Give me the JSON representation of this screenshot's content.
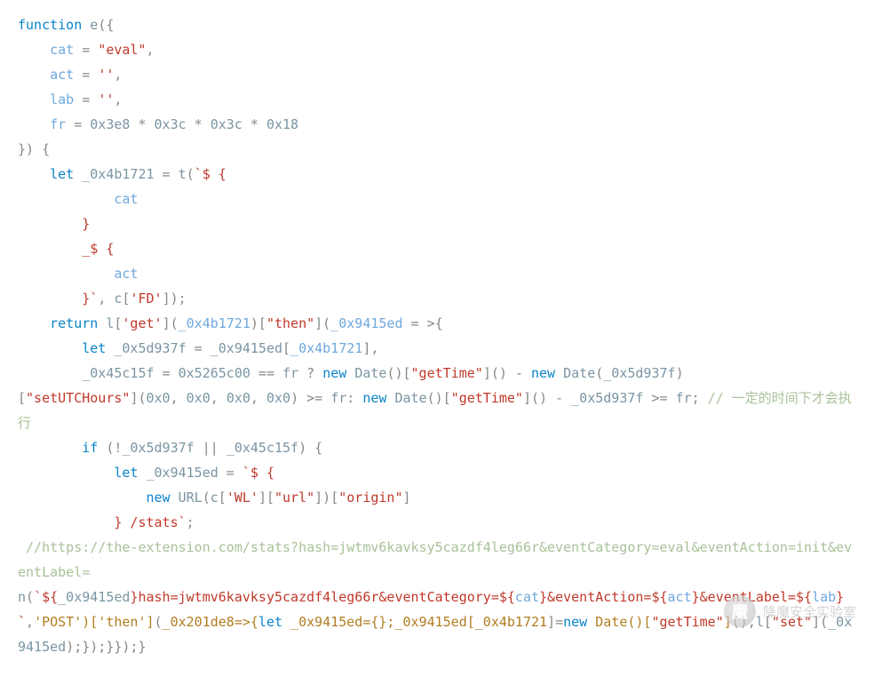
{
  "code": {
    "lines": [
      {
        "indent": 0,
        "spans": [
          [
            "kw",
            "function"
          ],
          [
            "",
            ""
          ],
          [
            "id",
            " e"
          ],
          [
            "op",
            "({"
          ]
        ]
      },
      {
        "indent": 1,
        "spans": [
          [
            "param",
            "cat"
          ],
          [
            "op",
            " = "
          ],
          [
            "str",
            "\"eval\""
          ],
          [
            "op",
            ","
          ]
        ]
      },
      {
        "indent": 1,
        "spans": [
          [
            "param",
            "act"
          ],
          [
            "op",
            " = "
          ],
          [
            "str",
            "''"
          ],
          [
            "op",
            ","
          ]
        ]
      },
      {
        "indent": 1,
        "spans": [
          [
            "param",
            "lab"
          ],
          [
            "op",
            " = "
          ],
          [
            "str",
            "''"
          ],
          [
            "op",
            ","
          ]
        ]
      },
      {
        "indent": 1,
        "spans": [
          [
            "param",
            "fr"
          ],
          [
            "op",
            " = "
          ],
          [
            "num",
            "0x3e8"
          ],
          [
            "op",
            " * "
          ],
          [
            "num",
            "0x3c"
          ],
          [
            "op",
            " * "
          ],
          [
            "num",
            "0x3c"
          ],
          [
            "op",
            " * "
          ],
          [
            "num",
            "0x18"
          ]
        ]
      },
      {
        "indent": 0,
        "spans": [
          [
            "op",
            "}) {"
          ]
        ]
      },
      {
        "indent": 1,
        "spans": [
          [
            "kw",
            "let"
          ],
          [
            "var",
            " _0x4b1721"
          ],
          [
            "op",
            " = "
          ],
          [
            "id",
            "t"
          ],
          [
            "op",
            "("
          ],
          [
            "tmpl",
            "`$ {"
          ]
        ]
      },
      {
        "indent": 3,
        "spans": [
          [
            "param",
            "cat"
          ]
        ]
      },
      {
        "indent": 2,
        "spans": [
          [
            "tmpl",
            "}"
          ]
        ]
      },
      {
        "indent": 2,
        "spans": [
          [
            "tmpl",
            "_$ {"
          ]
        ]
      },
      {
        "indent": 3,
        "spans": [
          [
            "param",
            "act"
          ]
        ]
      },
      {
        "indent": 2,
        "spans": [
          [
            "tmpl",
            "}`"
          ],
          [
            "op",
            ", "
          ],
          [
            "id",
            "c"
          ],
          [
            "op",
            "["
          ],
          [
            "prop",
            "'FD'"
          ],
          [
            "op",
            "]);"
          ]
        ]
      },
      {
        "indent": 1,
        "spans": [
          [
            "kw",
            "return"
          ],
          [
            "op",
            " "
          ],
          [
            "id",
            "l"
          ],
          [
            "op",
            "["
          ],
          [
            "prop",
            "'get'"
          ],
          [
            "op",
            "]("
          ],
          [
            "param",
            "_0x4b1721"
          ],
          [
            "op",
            ")["
          ],
          [
            "str",
            "\"then\""
          ],
          [
            "op",
            "]("
          ],
          [
            "param",
            "_0x9415ed "
          ],
          [
            "op",
            "= >{"
          ]
        ]
      },
      {
        "indent": 2,
        "spans": [
          [
            "kw",
            "let"
          ],
          [
            "var",
            " _0x5d937f"
          ],
          [
            "op",
            " = "
          ],
          [
            "id",
            "_0x9415ed"
          ],
          [
            "op",
            "["
          ],
          [
            "param",
            "_0x4b1721"
          ],
          [
            "op",
            "],"
          ]
        ]
      },
      {
        "indent": 2,
        "spans": [
          [
            "var",
            "_0x45c15f"
          ],
          [
            "op",
            " = "
          ],
          [
            "num",
            "0x5265c00"
          ],
          [
            "op",
            " == "
          ],
          [
            "id",
            "fr"
          ],
          [
            "op",
            " ? "
          ],
          [
            "kw",
            "new"
          ],
          [
            "op",
            " "
          ],
          [
            "id",
            "Date"
          ],
          [
            "op",
            "()["
          ],
          [
            "str",
            "\"getTime\""
          ],
          [
            "op",
            "]() - "
          ],
          [
            "kw",
            "new"
          ],
          [
            "op",
            " "
          ],
          [
            "id",
            "Date"
          ],
          [
            "op",
            "("
          ],
          [
            "id",
            "_0x5d937f"
          ],
          [
            "op",
            ")"
          ]
        ]
      },
      {
        "indent": 0,
        "spans": [
          [
            "op",
            "["
          ],
          [
            "str",
            "\"setUTCHours\""
          ],
          [
            "op",
            "]("
          ],
          [
            "num",
            "0x0"
          ],
          [
            "op",
            ", "
          ],
          [
            "num",
            "0x0"
          ],
          [
            "op",
            ", "
          ],
          [
            "num",
            "0x0"
          ],
          [
            "op",
            ", "
          ],
          [
            "num",
            "0x0"
          ],
          [
            "op",
            ") >= "
          ],
          [
            "id",
            "fr"
          ],
          [
            "op",
            ": "
          ],
          [
            "kw",
            "new"
          ],
          [
            "op",
            " "
          ],
          [
            "id",
            "Date"
          ],
          [
            "op",
            "()["
          ],
          [
            "str",
            "\"getTime\""
          ],
          [
            "op",
            "]() - "
          ],
          [
            "id",
            "_0x5d937f"
          ],
          [
            "op",
            " >= "
          ],
          [
            "id",
            "fr"
          ],
          [
            "op",
            "; "
          ],
          [
            "cmt",
            "// 一定的时间下才会执行"
          ]
        ]
      },
      {
        "indent": 2,
        "spans": [
          [
            "kw",
            "if"
          ],
          [
            "op",
            " (!"
          ],
          [
            "id",
            "_0x5d937f"
          ],
          [
            "op",
            " || "
          ],
          [
            "id",
            "_0x45c15f"
          ],
          [
            "op",
            ") {"
          ]
        ]
      },
      {
        "indent": 3,
        "spans": [
          [
            "kw",
            "let"
          ],
          [
            "var",
            " _0x9415ed"
          ],
          [
            "op",
            " = "
          ],
          [
            "tmpl",
            "`$ {"
          ]
        ]
      },
      {
        "indent": 4,
        "spans": [
          [
            "kw",
            "new"
          ],
          [
            "op",
            " "
          ],
          [
            "id",
            "URL"
          ],
          [
            "op",
            "("
          ],
          [
            "id",
            "c"
          ],
          [
            "op",
            "["
          ],
          [
            "prop",
            "'WL'"
          ],
          [
            "op",
            "]["
          ],
          [
            "str",
            "\"url\""
          ],
          [
            "op",
            "])["
          ],
          [
            "str",
            "\"origin\""
          ],
          [
            "op",
            "]"
          ]
        ]
      },
      {
        "indent": 3,
        "spans": [
          [
            "tmpl",
            "} /stats`"
          ],
          [
            "op",
            ";"
          ]
        ]
      },
      {
        "indent": 0,
        "spans": [
          [
            "cmt",
            " //https://the-extension.com/stats?hash=jwtmv6kavksy5cazdf4leg66r&eventCategory=eval&eventAction=init&eventLabel= "
          ]
        ]
      },
      {
        "indent": 0,
        "spans": [
          [
            "id",
            "n"
          ],
          [
            "op",
            "("
          ],
          [
            "tmpl",
            "`${"
          ],
          [
            "id",
            "_0x9415ed"
          ],
          [
            "tmpl",
            "}hash=jwtmv6kavksy5cazdf4leg66r&eventCategory=${"
          ],
          [
            "param",
            "cat"
          ],
          [
            "tmpl",
            "}&eventAction=${"
          ],
          [
            "param",
            "act"
          ],
          [
            "tmpl",
            "}&eventLabel=${"
          ],
          [
            "param",
            "lab"
          ],
          [
            "tmpl",
            "}`"
          ],
          [
            "op",
            ","
          ],
          [
            "gold",
            "'POST')['then']"
          ],
          [
            "op",
            "("
          ],
          [
            "gold",
            "_0x201de8=>{"
          ],
          [
            "kw",
            "let"
          ],
          [
            "gold",
            " _0x9415ed={};_0x9415ed[_0x4b1721"
          ],
          [
            "op",
            "]="
          ],
          [
            "kw",
            "new"
          ],
          [
            "op",
            " "
          ],
          [
            "gold",
            "Date()["
          ],
          [
            "str",
            "\"getTime\""
          ],
          [
            "gold",
            "]"
          ],
          [
            "op",
            "(),"
          ],
          [
            "id",
            "l"
          ],
          [
            "op",
            "["
          ],
          [
            "str",
            "\"set\""
          ],
          [
            "op",
            "]("
          ],
          [
            "id",
            "_0x9415ed"
          ],
          [
            "op",
            ");});}});}"
          ]
        ]
      }
    ]
  },
  "watermark": {
    "label": "降魔安全实验室",
    "badge_glyph": "魔"
  }
}
